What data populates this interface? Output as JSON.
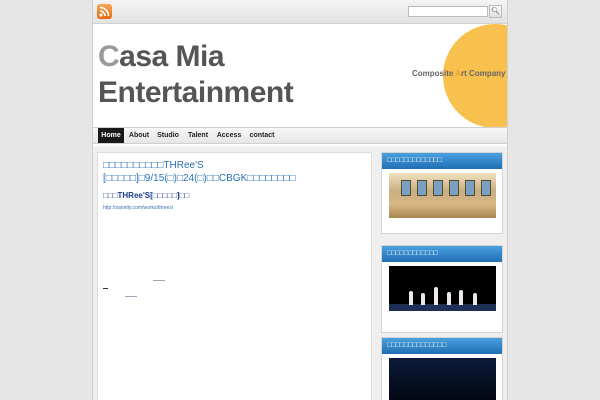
{
  "topbar": {
    "rss_icon": "rss-icon",
    "search_placeholder": "",
    "search_button_icon": "search-icon"
  },
  "header": {
    "brand_c": "C",
    "brand_line1_rest": "asa Mia",
    "brand_line2": "Entertainment",
    "tagline_pre": "Composite ",
    "tagline_a": "A",
    "tagline_post": "rt Company",
    "accent_color": "#f8c04d"
  },
  "nav": {
    "items": [
      {
        "label": "Home",
        "active": true
      },
      {
        "label": "About",
        "active": false
      },
      {
        "label": "Studio",
        "active": false
      },
      {
        "label": "Talent",
        "active": false
      },
      {
        "label": "Access",
        "active": false
      },
      {
        "label": "contact",
        "active": false
      }
    ]
  },
  "post": {
    "title": "□□□□□□□□□□THRee'S [□□□□□]□9/15(□)□24(□)□□CBGK□□□□□□□□",
    "subtitle": "□□□THRee'S[□□□□□]□□",
    "link": "http://sanetty.com/works/threes/"
  },
  "sidebar": {
    "widgets": [
      {
        "title": "□□□□□□□□□□□□□",
        "image": "dance-studio-photo"
      },
      {
        "title": "□□□□□□□□□□□□",
        "image": "stage-performance-photo"
      },
      {
        "title": "□□□□□□□□□□□□□□",
        "image": "dark-stage-photo"
      }
    ]
  },
  "colors": {
    "link_blue": "#2670b6",
    "widget_header": "#2a82c8",
    "active_nav": "#1a1a1a"
  }
}
